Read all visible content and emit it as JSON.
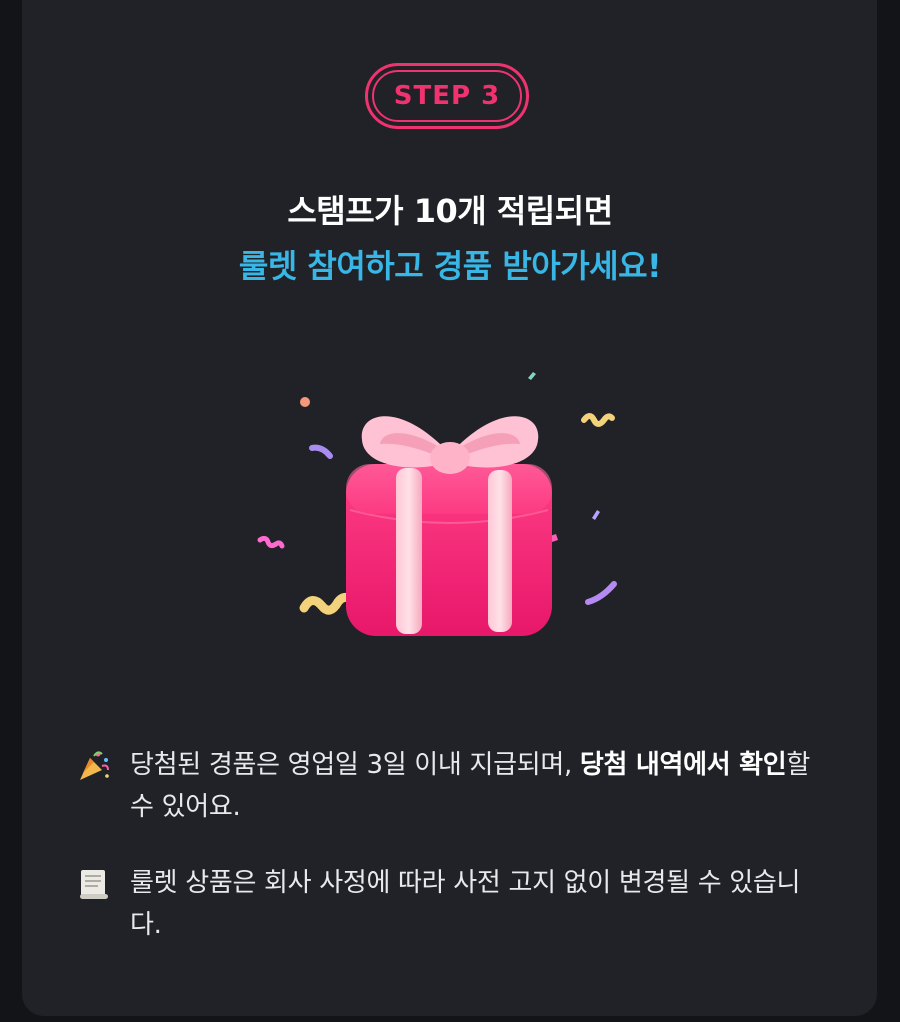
{
  "step": {
    "label": "STEP 3"
  },
  "title": {
    "line1": "스탬프가 10개 적립되면",
    "line2": "룰렛 참여하고 경품 받아가세요!"
  },
  "notes": [
    {
      "icon": "party-popper-icon",
      "text_before": "당첨된 경품은 영업일 3일 이내 지급되며, ",
      "bold": "당첨 내역에서 확인",
      "text_after": "할 수 있어요."
    },
    {
      "icon": "scroll-icon",
      "text": "룰렛 상품은 회사 사정에 따라 사전 고지 없이 변경될 수 있습니다."
    }
  ],
  "colors": {
    "accent_pink": "#f0336f",
    "accent_blue": "#38b6e6",
    "card_bg": "#212227",
    "page_bg": "#131418"
  }
}
